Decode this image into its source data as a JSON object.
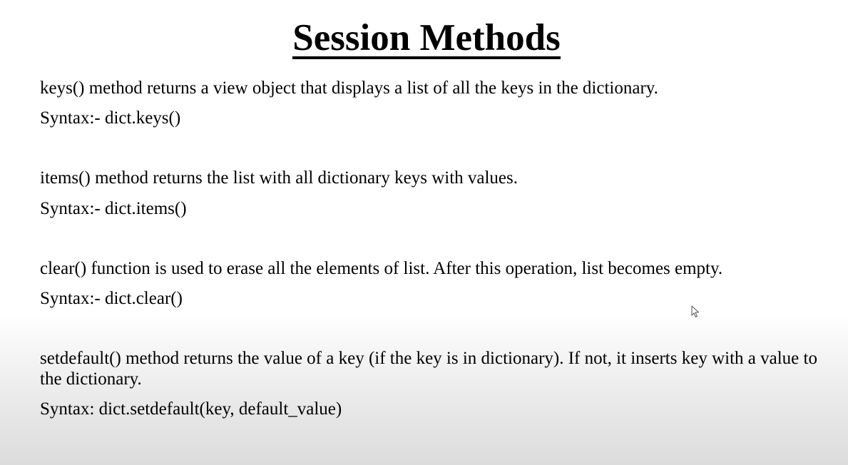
{
  "slide": {
    "title": "Session Methods",
    "sections": [
      {
        "description": "keys() method returns a view object that displays a list of all the keys in the dictionary.",
        "syntax": "Syntax:- dict.keys()"
      },
      {
        "description": "items() method returns the list with all dictionary keys with values.",
        "syntax": "Syntax:- dict.items()"
      },
      {
        "description": "clear() function is used to erase all the elements of list. After this operation, list becomes empty.",
        "syntax": "Syntax:- dict.clear()"
      },
      {
        "description": "setdefault() method returns the value of a key (if the key is in dictionary). If not, it inserts key with a value to the dictionary.",
        "syntax": "Syntax: dict.setdefault(key, default_value)"
      }
    ]
  },
  "icons": {
    "cursor": "mouse-pointer-icon"
  }
}
